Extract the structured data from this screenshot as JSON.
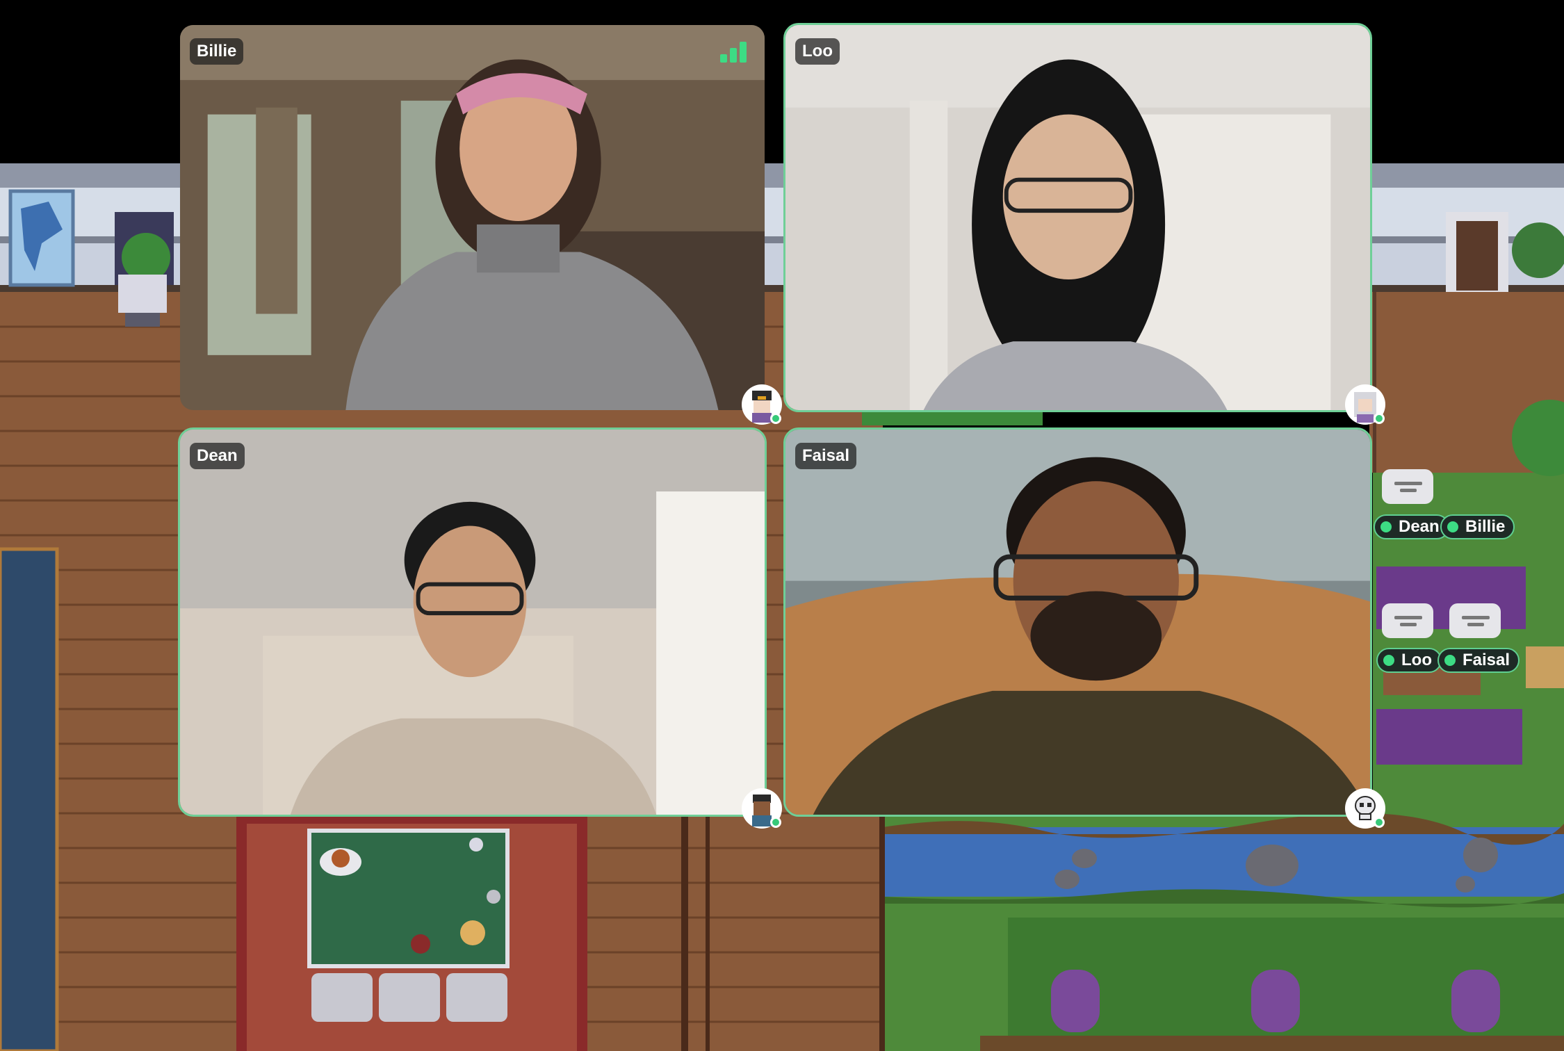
{
  "participants": [
    {
      "name": "Billie",
      "signal_bars": 3
    },
    {
      "name": "Loo"
    },
    {
      "name": "Dean"
    },
    {
      "name": "Faisal"
    }
  ],
  "map_labels": {
    "dean": "Dean",
    "billie": "Billie",
    "loo": "Loo",
    "faisal": "Faisal"
  },
  "colors": {
    "active_border": "#6fcf97",
    "online_dot": "#37c979",
    "label_bg": "#1e2a26"
  }
}
